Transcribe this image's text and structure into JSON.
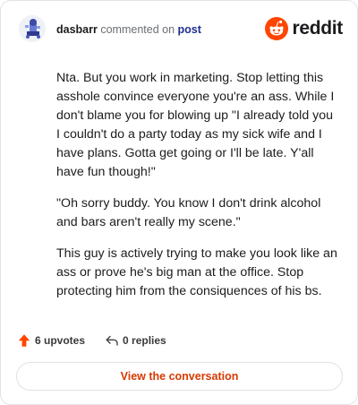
{
  "header": {
    "username": "dasbarr",
    "commented_text": "commented on",
    "post_link": "post",
    "brand": "reddit"
  },
  "comment": {
    "paragraphs": [
      "Nta. But you work in marketing. Stop letting this asshole convince everyone you're an ass. While I don't blame you for blowing up \"I already told you I couldn't do a party today as my sick wife and I have plans. Gotta get going or I'll be late. Y'all have fun though!\"",
      "\"Oh sorry buddy. You know I don't drink alcohol and bars aren't really my scene.\"",
      "This guy is actively trying to make you look like an ass or prove he's big man at the office. Stop protecting him from the consiquences of his bs."
    ]
  },
  "actions": {
    "upvotes": "6 upvotes",
    "replies": "0 replies"
  },
  "cta": {
    "label": "View the conversation"
  },
  "icons": {
    "avatar": "user-avatar",
    "brand": "reddit-snoo-icon",
    "upvote": "upvote-arrow-icon",
    "reply": "reply-arrow-icon"
  },
  "colors": {
    "accent": "#ff4500",
    "cta_text": "#d93a00",
    "post_link": "#1f2f8f"
  }
}
